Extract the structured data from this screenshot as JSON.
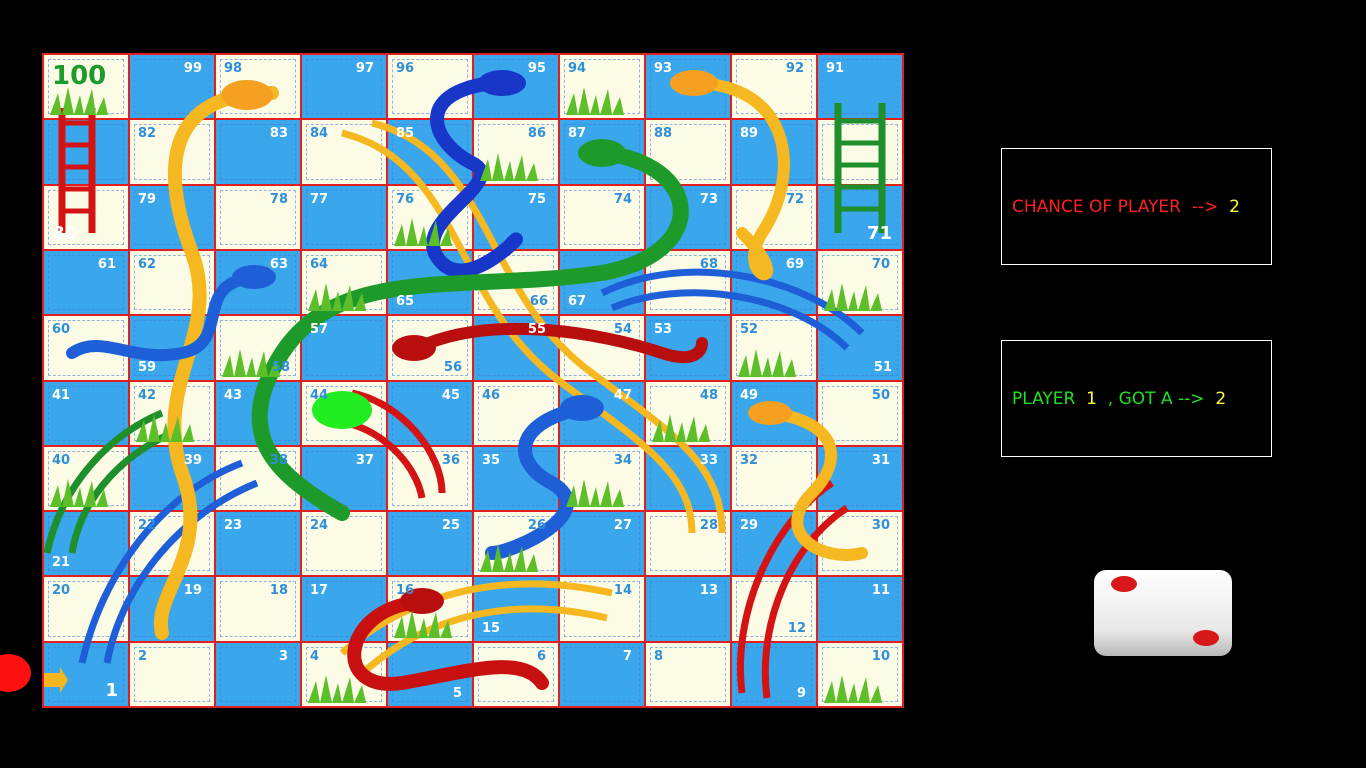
{
  "board": {
    "top_label": "100",
    "cells": [
      {
        "n": "100",
        "pos": "tl",
        "bg": 1
      },
      {
        "n": "99",
        "pos": "tr",
        "bg": 0
      },
      {
        "n": "98",
        "pos": "tl",
        "bg": 1
      },
      {
        "n": "97",
        "pos": "tr",
        "bg": 0
      },
      {
        "n": "96",
        "pos": "tl",
        "bg": 1
      },
      {
        "n": "95",
        "pos": "tr",
        "bg": 0
      },
      {
        "n": "94",
        "pos": "tl",
        "bg": 1
      },
      {
        "n": "93",
        "pos": "tl",
        "bg": 0
      },
      {
        "n": "92",
        "pos": "tr",
        "bg": 1
      },
      {
        "n": "91",
        "pos": "tl",
        "bg": 0
      },
      {
        "n": "",
        "pos": "tl",
        "bg": 0
      },
      {
        "n": "82",
        "pos": "tl",
        "bg": 1
      },
      {
        "n": "83",
        "pos": "tr",
        "bg": 0
      },
      {
        "n": "84",
        "pos": "tl",
        "bg": 1
      },
      {
        "n": "85",
        "pos": "tl",
        "bg": 0
      },
      {
        "n": "86",
        "pos": "tr",
        "bg": 1
      },
      {
        "n": "87",
        "pos": "tl",
        "bg": 0
      },
      {
        "n": "88",
        "pos": "tl",
        "bg": 1
      },
      {
        "n": "89",
        "pos": "tl",
        "bg": 0
      },
      {
        "n": "",
        "pos": "tl",
        "bg": 1
      },
      {
        "n": "80",
        "pos": "bl",
        "bg": 1
      },
      {
        "n": "79",
        "pos": "tl",
        "bg": 0
      },
      {
        "n": "78",
        "pos": "tr",
        "bg": 1
      },
      {
        "n": "77",
        "pos": "tl",
        "bg": 0
      },
      {
        "n": "76",
        "pos": "tl",
        "bg": 1
      },
      {
        "n": "75",
        "pos": "tr",
        "bg": 0
      },
      {
        "n": "74",
        "pos": "tr",
        "bg": 1
      },
      {
        "n": "73",
        "pos": "tr",
        "bg": 0
      },
      {
        "n": "72",
        "pos": "tr",
        "bg": 1
      },
      {
        "n": "71",
        "pos": "br",
        "bg": 0
      },
      {
        "n": "61",
        "pos": "tr",
        "bg": 0
      },
      {
        "n": "62",
        "pos": "tl",
        "bg": 1
      },
      {
        "n": "63",
        "pos": "tr",
        "bg": 0
      },
      {
        "n": "64",
        "pos": "tl",
        "bg": 1
      },
      {
        "n": "65",
        "pos": "bl",
        "bg": 0
      },
      {
        "n": "66",
        "pos": "br",
        "bg": 1
      },
      {
        "n": "67",
        "pos": "bl",
        "bg": 0
      },
      {
        "n": "68",
        "pos": "tr",
        "bg": 1
      },
      {
        "n": "69",
        "pos": "tr",
        "bg": 0
      },
      {
        "n": "70",
        "pos": "tr",
        "bg": 1
      },
      {
        "n": "60",
        "pos": "tl",
        "bg": 1
      },
      {
        "n": "59",
        "pos": "bl",
        "bg": 0
      },
      {
        "n": "58",
        "pos": "br",
        "bg": 1
      },
      {
        "n": "57",
        "pos": "tl",
        "bg": 0
      },
      {
        "n": "56",
        "pos": "br",
        "bg": 1
      },
      {
        "n": "55",
        "pos": "tr",
        "bg": 0
      },
      {
        "n": "54",
        "pos": "tr",
        "bg": 1
      },
      {
        "n": "53",
        "pos": "tl",
        "bg": 0
      },
      {
        "n": "52",
        "pos": "tl",
        "bg": 1
      },
      {
        "n": "51",
        "pos": "br",
        "bg": 0
      },
      {
        "n": "41",
        "pos": "tl",
        "bg": 0
      },
      {
        "n": "42",
        "pos": "tl",
        "bg": 1
      },
      {
        "n": "43",
        "pos": "tl",
        "bg": 0
      },
      {
        "n": "44",
        "pos": "tl",
        "bg": 1
      },
      {
        "n": "45",
        "pos": "tr",
        "bg": 0
      },
      {
        "n": "46",
        "pos": "tl",
        "bg": 1
      },
      {
        "n": "47",
        "pos": "tr",
        "bg": 0
      },
      {
        "n": "48",
        "pos": "tr",
        "bg": 1
      },
      {
        "n": "49",
        "pos": "tl",
        "bg": 0
      },
      {
        "n": "50",
        "pos": "tr",
        "bg": 1
      },
      {
        "n": "40",
        "pos": "tl",
        "bg": 1
      },
      {
        "n": "39",
        "pos": "tr",
        "bg": 0
      },
      {
        "n": "38",
        "pos": "tr",
        "bg": 1
      },
      {
        "n": "37",
        "pos": "tr",
        "bg": 0
      },
      {
        "n": "36",
        "pos": "tr",
        "bg": 1
      },
      {
        "n": "35",
        "pos": "tl",
        "bg": 0
      },
      {
        "n": "34",
        "pos": "tr",
        "bg": 1
      },
      {
        "n": "33",
        "pos": "tr",
        "bg": 0
      },
      {
        "n": "32",
        "pos": "tl",
        "bg": 1
      },
      {
        "n": "31",
        "pos": "tr",
        "bg": 0
      },
      {
        "n": "21",
        "pos": "bl",
        "bg": 0
      },
      {
        "n": "22",
        "pos": "tl",
        "bg": 1
      },
      {
        "n": "23",
        "pos": "tl",
        "bg": 0
      },
      {
        "n": "24",
        "pos": "tl",
        "bg": 1
      },
      {
        "n": "25",
        "pos": "tr",
        "bg": 0
      },
      {
        "n": "26",
        "pos": "tr",
        "bg": 1
      },
      {
        "n": "27",
        "pos": "tr",
        "bg": 0
      },
      {
        "n": "28",
        "pos": "tr",
        "bg": 1
      },
      {
        "n": "29",
        "pos": "tl",
        "bg": 0
      },
      {
        "n": "30",
        "pos": "tr",
        "bg": 1
      },
      {
        "n": "20",
        "pos": "tl",
        "bg": 1
      },
      {
        "n": "19",
        "pos": "tr",
        "bg": 0
      },
      {
        "n": "18",
        "pos": "tr",
        "bg": 1
      },
      {
        "n": "17",
        "pos": "tl",
        "bg": 0
      },
      {
        "n": "16",
        "pos": "tl",
        "bg": 1
      },
      {
        "n": "15",
        "pos": "bl",
        "bg": 0
      },
      {
        "n": "14",
        "pos": "tr",
        "bg": 1
      },
      {
        "n": "13",
        "pos": "tr",
        "bg": 0
      },
      {
        "n": "12",
        "pos": "br",
        "bg": 1
      },
      {
        "n": "11",
        "pos": "tr",
        "bg": 0
      },
      {
        "n": "1",
        "pos": "br",
        "bg": 0
      },
      {
        "n": "2",
        "pos": "tl",
        "bg": 1
      },
      {
        "n": "3",
        "pos": "tr",
        "bg": 0
      },
      {
        "n": "4",
        "pos": "tl",
        "bg": 1
      },
      {
        "n": "5",
        "pos": "br",
        "bg": 0
      },
      {
        "n": "6",
        "pos": "tr",
        "bg": 1
      },
      {
        "n": "7",
        "pos": "tr",
        "bg": 0
      },
      {
        "n": "8",
        "pos": "tl",
        "bg": 1
      },
      {
        "n": "9",
        "pos": "br",
        "bg": 0
      },
      {
        "n": "10",
        "pos": "tr",
        "bg": 1
      }
    ]
  },
  "chance_panel": {
    "label": "CHANCE OF PLAYER  -->  ",
    "value": "2",
    "label_color": "#ff2020",
    "value_color": "#ffff30"
  },
  "roll_panel": {
    "label_player": "PLAYER  ",
    "player_number": "1",
    "label_got": "  , GOT A -->  ",
    "roll_value": "2",
    "label_color": "#20e020",
    "value_color": "#ffff30"
  },
  "dice": {
    "face_value": 2,
    "pip_color": "#d81818"
  },
  "tokens": [
    {
      "name": "player1-token",
      "color": "#ff1010"
    },
    {
      "name": "player2-token",
      "color": "#20ee20",
      "square": "44"
    }
  ]
}
